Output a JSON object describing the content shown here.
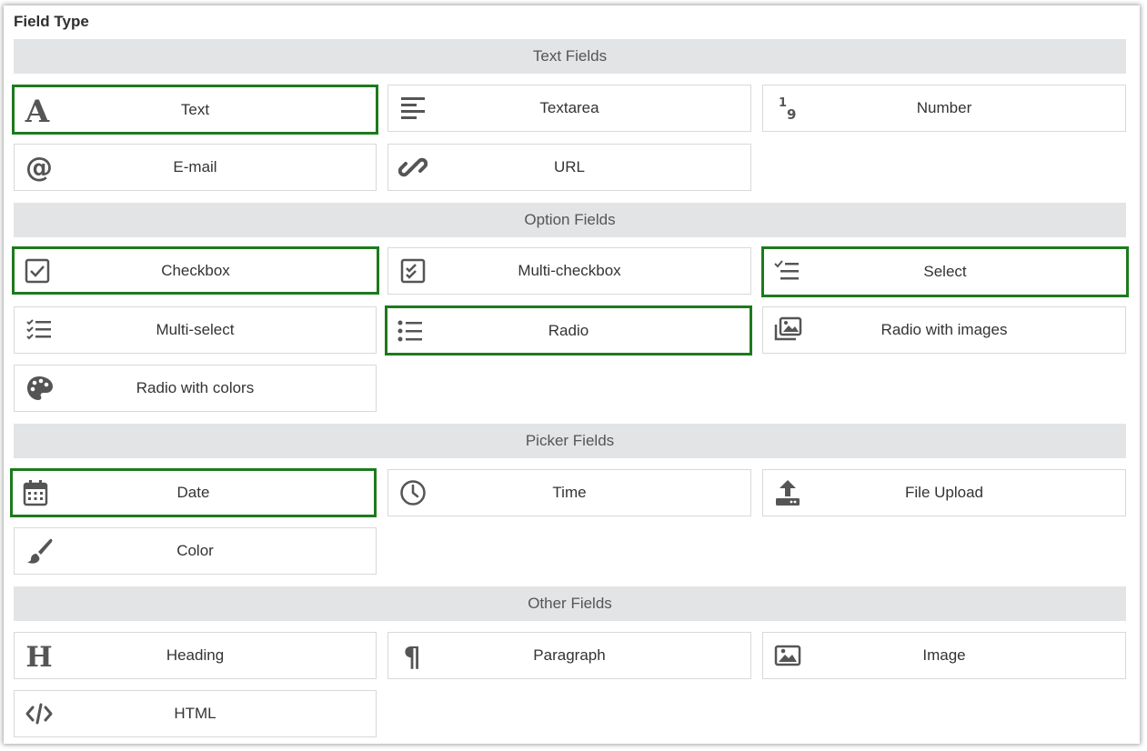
{
  "title": "Field Type",
  "colors": {
    "selected_border": "#1d7a1d",
    "header_bg": "#e3e4e6",
    "icon": "#555555"
  },
  "sections": [
    {
      "label": "Text Fields",
      "items": [
        {
          "label": "Text",
          "icon": "font-icon",
          "selected": true
        },
        {
          "label": "Textarea",
          "icon": "align-left-icon",
          "selected": false
        },
        {
          "label": "Number",
          "icon": "number-icon",
          "selected": false
        },
        {
          "label": "E-mail",
          "icon": "at-icon",
          "selected": false
        },
        {
          "label": "URL",
          "icon": "link-icon",
          "selected": false
        }
      ]
    },
    {
      "label": "Option Fields",
      "items": [
        {
          "label": "Checkbox",
          "icon": "checkbox-icon",
          "selected": true
        },
        {
          "label": "Multi-checkbox",
          "icon": "multi-checkbox-icon",
          "selected": false
        },
        {
          "label": "Select",
          "icon": "select-list-icon",
          "selected": true
        },
        {
          "label": "Multi-select",
          "icon": "checklist-icon",
          "selected": false
        },
        {
          "label": "Radio",
          "icon": "list-icon",
          "selected": true
        },
        {
          "label": "Radio with images",
          "icon": "images-icon",
          "selected": false
        },
        {
          "label": "Radio with colors",
          "icon": "palette-icon",
          "selected": false
        }
      ]
    },
    {
      "label": "Picker Fields",
      "items": [
        {
          "label": "Date",
          "icon": "calendar-icon",
          "selected": true
        },
        {
          "label": "Time",
          "icon": "clock-icon",
          "selected": false
        },
        {
          "label": "File Upload",
          "icon": "upload-icon",
          "selected": false
        },
        {
          "label": "Color",
          "icon": "paintbrush-icon",
          "selected": false
        }
      ]
    },
    {
      "label": "Other Fields",
      "items": [
        {
          "label": "Heading",
          "icon": "heading-icon",
          "selected": false
        },
        {
          "label": "Paragraph",
          "icon": "paragraph-icon",
          "selected": false
        },
        {
          "label": "Image",
          "icon": "image-icon",
          "selected": false
        },
        {
          "label": "HTML",
          "icon": "code-icon",
          "selected": false
        }
      ]
    }
  ]
}
